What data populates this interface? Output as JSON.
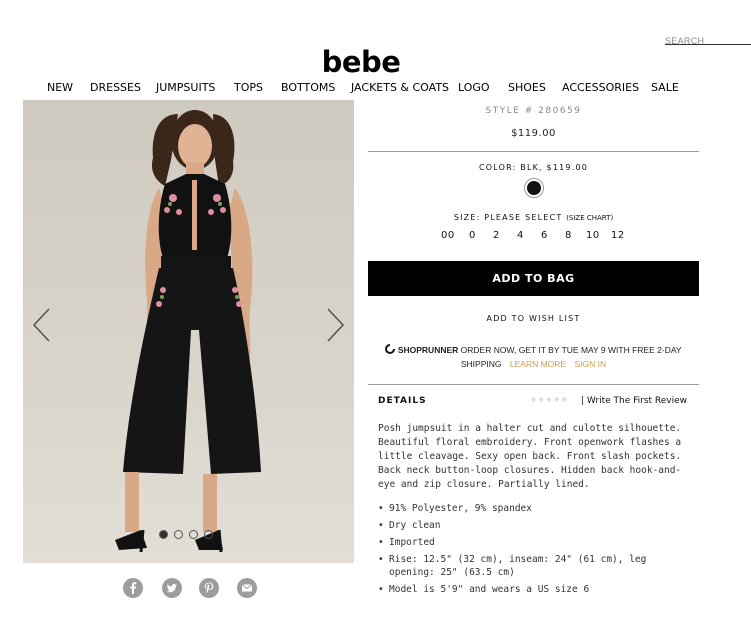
{
  "header": {
    "search_placeholder": "SEARCH",
    "logo": "bebe"
  },
  "nav": [
    "NEW",
    "DRESSES",
    "JUMPSUITS",
    "TOPS",
    "BOTTOMS",
    "JACKETS & COATS",
    "LOGO",
    "SHOES",
    "ACCESSORIES",
    "SALE"
  ],
  "gallery": {
    "current_slide": 1,
    "slide_count": 4
  },
  "share": [
    "facebook-icon",
    "twitter-icon",
    "pinterest-icon",
    "email-icon"
  ],
  "product": {
    "style": "STYLE # 280659",
    "price": "$119.00",
    "color_label": "COLOR: BLK, $119.00",
    "swatch_color": "#111111",
    "size_label": "SIZE: PLEASE SELECT",
    "size_chart": "(SIZE CHART)",
    "sizes": [
      "00",
      "0",
      "2",
      "4",
      "6",
      "8",
      "10",
      "12"
    ],
    "add_to_bag": "ADD TO BAG",
    "wish_list": "ADD TO WISH LIST"
  },
  "shoprunner": {
    "logo": "SHOPRUNNER",
    "text": "ORDER NOW, GET IT BY TUE MAY 9 WITH FREE 2-DAY",
    "text2": "SHIPPING",
    "learn_more": "LEARN MORE",
    "sign_in": "SIGN IN",
    "accent": "#d39b4a"
  },
  "details": {
    "heading": "DETAILS",
    "stars": "★★★★★",
    "review": "| Write The First Review",
    "description": "Posh jumpsuit in a halter cut and culotte silhouette. Beautiful floral embroidery. Front openwork flashes a little cleavage. Sexy open back. Front slash pockets. Back neck button-loop closures. Hidden back hook-and-eye and zip closure. Partially lined.",
    "bullets": [
      "91% Polyester, 9% spandex",
      "Dry clean",
      "Imported",
      "Rise: 12.5\" (32 cm), inseam: 24\" (61 cm), leg opening: 25\" (63.5 cm)",
      "Model is 5'9\" and wears a US size 6"
    ]
  }
}
